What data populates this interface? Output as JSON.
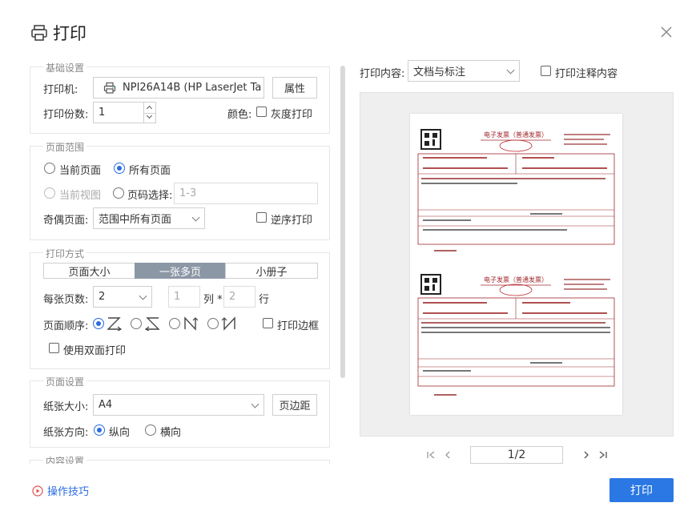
{
  "dialog": {
    "title": "打印",
    "print_label": "打印",
    "tips_label": "操作技巧"
  },
  "basic": {
    "title": "基础设置",
    "printer_label": "打印机:",
    "printer_value": "NPI26A14B (HP LaserJet Ta",
    "properties_label": "属性",
    "copies_label": "打印份数:",
    "copies_value": "1",
    "color_label": "颜色:",
    "grayscale_label": "灰度打印"
  },
  "range": {
    "title": "页面范围",
    "current_page": "当前页面",
    "all_pages": "所有页面",
    "current_view": "当前视图",
    "page_select": "页码选择:",
    "page_select_placeholder": "1-3",
    "odd_even_label": "奇偶页面:",
    "odd_even_value": "范围中所有页面",
    "reverse_label": "逆序打印"
  },
  "method": {
    "title": "打印方式",
    "tabs": [
      "页面大小",
      "一张多页",
      "小册子"
    ],
    "per_sheet_label": "每张页数:",
    "per_sheet_value": "2",
    "cols_value": "1",
    "cols_label": "列 *",
    "rows_value": "2",
    "rows_label": "行",
    "order_label": "页面顺序:",
    "border_label": "打印边框",
    "duplex_label": "使用双面打印"
  },
  "page_setup": {
    "title": "页面设置",
    "paper_label": "纸张大小:",
    "paper_value": "A4",
    "margin_label": "页边距",
    "orient_label": "纸张方向:",
    "portrait": "纵向",
    "landscape": "横向"
  },
  "content": {
    "title": "内容设置"
  },
  "preview": {
    "content_label": "打印内容:",
    "content_value": "文档与标注",
    "annot_label": "打印注释内容",
    "page_indicator": "1/2",
    "invoice_title": "电子发票（普通发票）"
  }
}
